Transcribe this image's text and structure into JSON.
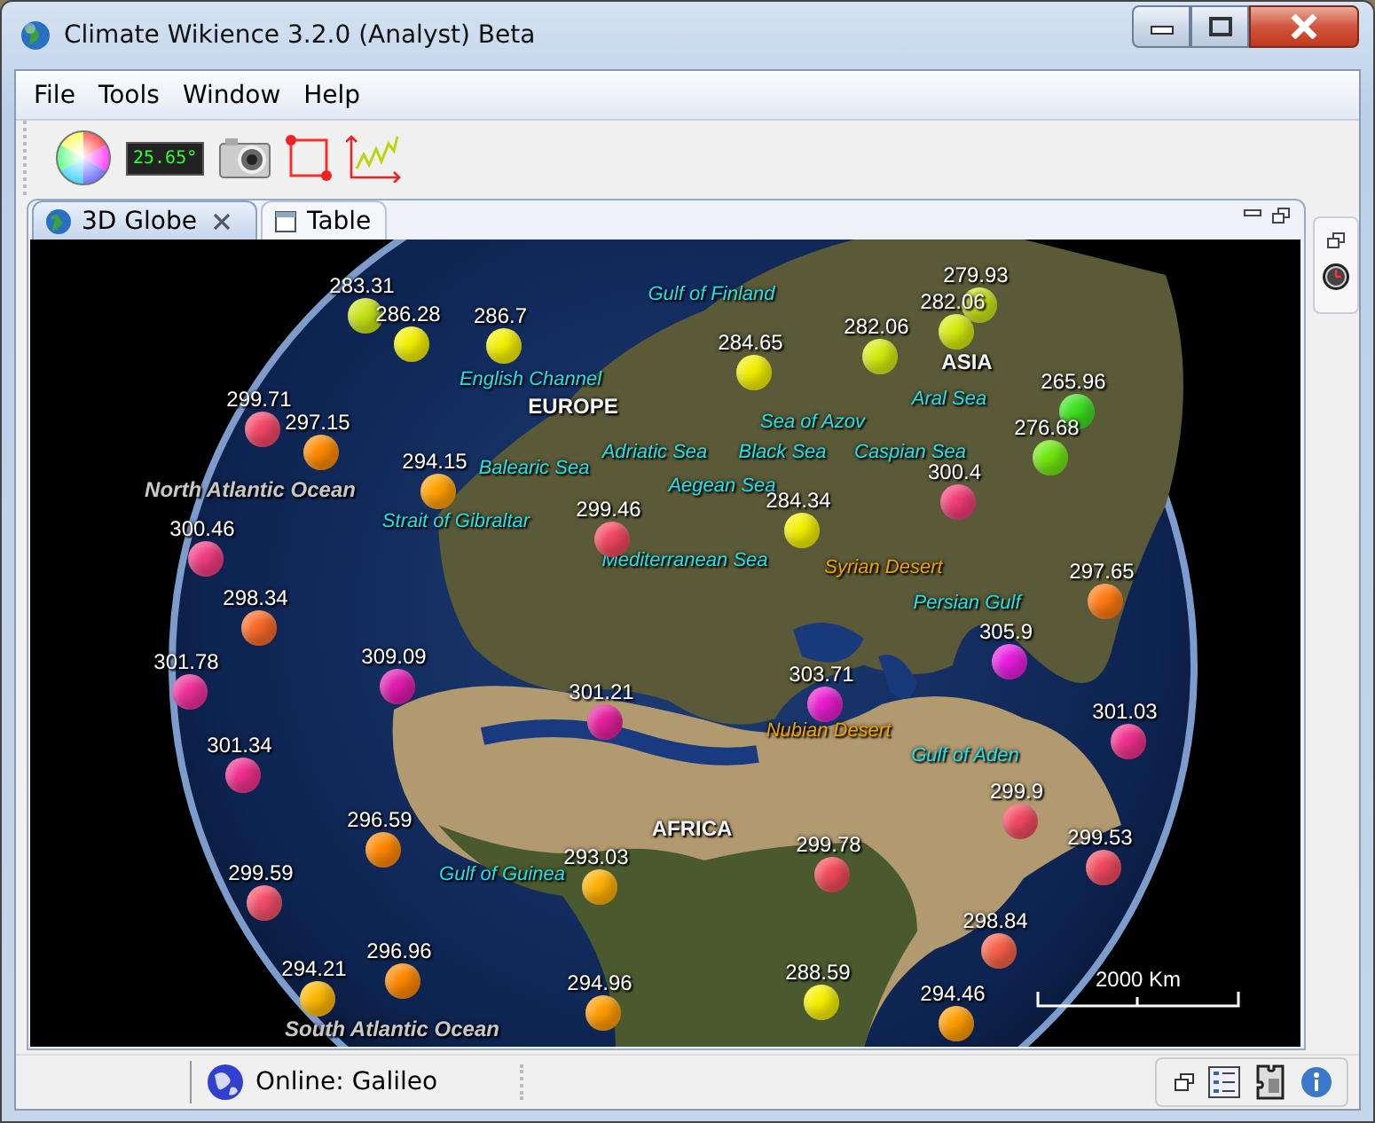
{
  "window": {
    "title": "Climate Wikience 3.2.0 (Analyst) Beta"
  },
  "menu": [
    {
      "label": "File"
    },
    {
      "label": "Tools"
    },
    {
      "label": "Window"
    },
    {
      "label": "Help"
    }
  ],
  "toolbar": {
    "temperature_display": "25.65°"
  },
  "tabs": [
    {
      "label": "3D Globe",
      "selected": true,
      "closable": true
    },
    {
      "label": "Table",
      "selected": false,
      "closable": false
    }
  ],
  "globe": {
    "markers": [
      {
        "value": "283.31",
        "color": "#c8e418"
      },
      {
        "value": "286.28",
        "color": "#f2f000"
      },
      {
        "value": "286.7",
        "color": "#f2f000"
      },
      {
        "value": "284.65",
        "color": "#f2f000"
      },
      {
        "value": "282.06",
        "color": "#d4ec10"
      },
      {
        "value": "282.06",
        "color": "#d4ec10"
      },
      {
        "value": "279.93",
        "color": "#c8e418"
      },
      {
        "value": "265.96",
        "color": "#3ee020"
      },
      {
        "value": "276.68",
        "color": "#70e810"
      },
      {
        "value": "299.71",
        "color": "#f24866"
      },
      {
        "value": "297.15",
        "color": "#ff8a00"
      },
      {
        "value": "294.15",
        "color": "#ffa000"
      },
      {
        "value": "299.46",
        "color": "#f24860"
      },
      {
        "value": "300.4",
        "color": "#f23c78"
      },
      {
        "value": "284.34",
        "color": "#f2f000"
      },
      {
        "value": "297.65",
        "color": "#ff7a10"
      },
      {
        "value": "300.46",
        "color": "#f03c80"
      },
      {
        "value": "298.34",
        "color": "#f86a28"
      },
      {
        "value": "305.9",
        "color": "#e81ee0"
      },
      {
        "value": "309.09",
        "color": "#e01cb0"
      },
      {
        "value": "301.78",
        "color": "#f0309a"
      },
      {
        "value": "301.21",
        "color": "#e4209e"
      },
      {
        "value": "303.71",
        "color": "#e81ed0"
      },
      {
        "value": "301.03",
        "color": "#f0308e"
      },
      {
        "value": "301.34",
        "color": "#f0308e"
      },
      {
        "value": "299.9",
        "color": "#f24a60"
      },
      {
        "value": "296.59",
        "color": "#ff8800"
      },
      {
        "value": "299.53",
        "color": "#f24a60"
      },
      {
        "value": "293.03",
        "color": "#ffb000"
      },
      {
        "value": "299.78",
        "color": "#f24a5a"
      },
      {
        "value": "299.59",
        "color": "#f2506a"
      },
      {
        "value": "298.84",
        "color": "#f86048"
      },
      {
        "value": "296.96",
        "color": "#ff8800"
      },
      {
        "value": "294.21",
        "color": "#ffb800"
      },
      {
        "value": "288.59",
        "color": "#f8f000"
      },
      {
        "value": "294.96",
        "color": "#ff9c00"
      },
      {
        "value": "294.46",
        "color": "#ff9c00"
      }
    ],
    "places": [
      {
        "name": "Gulf of Finland",
        "kind": "water"
      },
      {
        "name": "ASIA",
        "kind": "continent"
      },
      {
        "name": "English Channel",
        "kind": "water"
      },
      {
        "name": "Aral Sea",
        "kind": "water"
      },
      {
        "name": "EUROPE",
        "kind": "continent"
      },
      {
        "name": "Sea of Azov",
        "kind": "water"
      },
      {
        "name": "Adriatic Sea",
        "kind": "water"
      },
      {
        "name": "Black Sea",
        "kind": "water"
      },
      {
        "name": "Caspian Sea",
        "kind": "water"
      },
      {
        "name": "Balearic Sea",
        "kind": "water"
      },
      {
        "name": "Aegean Sea",
        "kind": "water"
      },
      {
        "name": "North Atlantic Ocean",
        "kind": "ocean"
      },
      {
        "name": "Strait of Gibraltar",
        "kind": "water"
      },
      {
        "name": "Mediterranean Sea",
        "kind": "water"
      },
      {
        "name": "Syrian Desert",
        "kind": "desert"
      },
      {
        "name": "Persian Gulf",
        "kind": "water"
      },
      {
        "name": "Nubian Desert",
        "kind": "desert"
      },
      {
        "name": "Gulf of Aden",
        "kind": "water"
      },
      {
        "name": "AFRICA",
        "kind": "continent"
      },
      {
        "name": "Gulf of Guinea",
        "kind": "water"
      },
      {
        "name": "South Atlantic Ocean",
        "kind": "ocean"
      }
    ],
    "scale_label": "2000 Km"
  },
  "status_bar": {
    "text": "Online: Galileo"
  }
}
